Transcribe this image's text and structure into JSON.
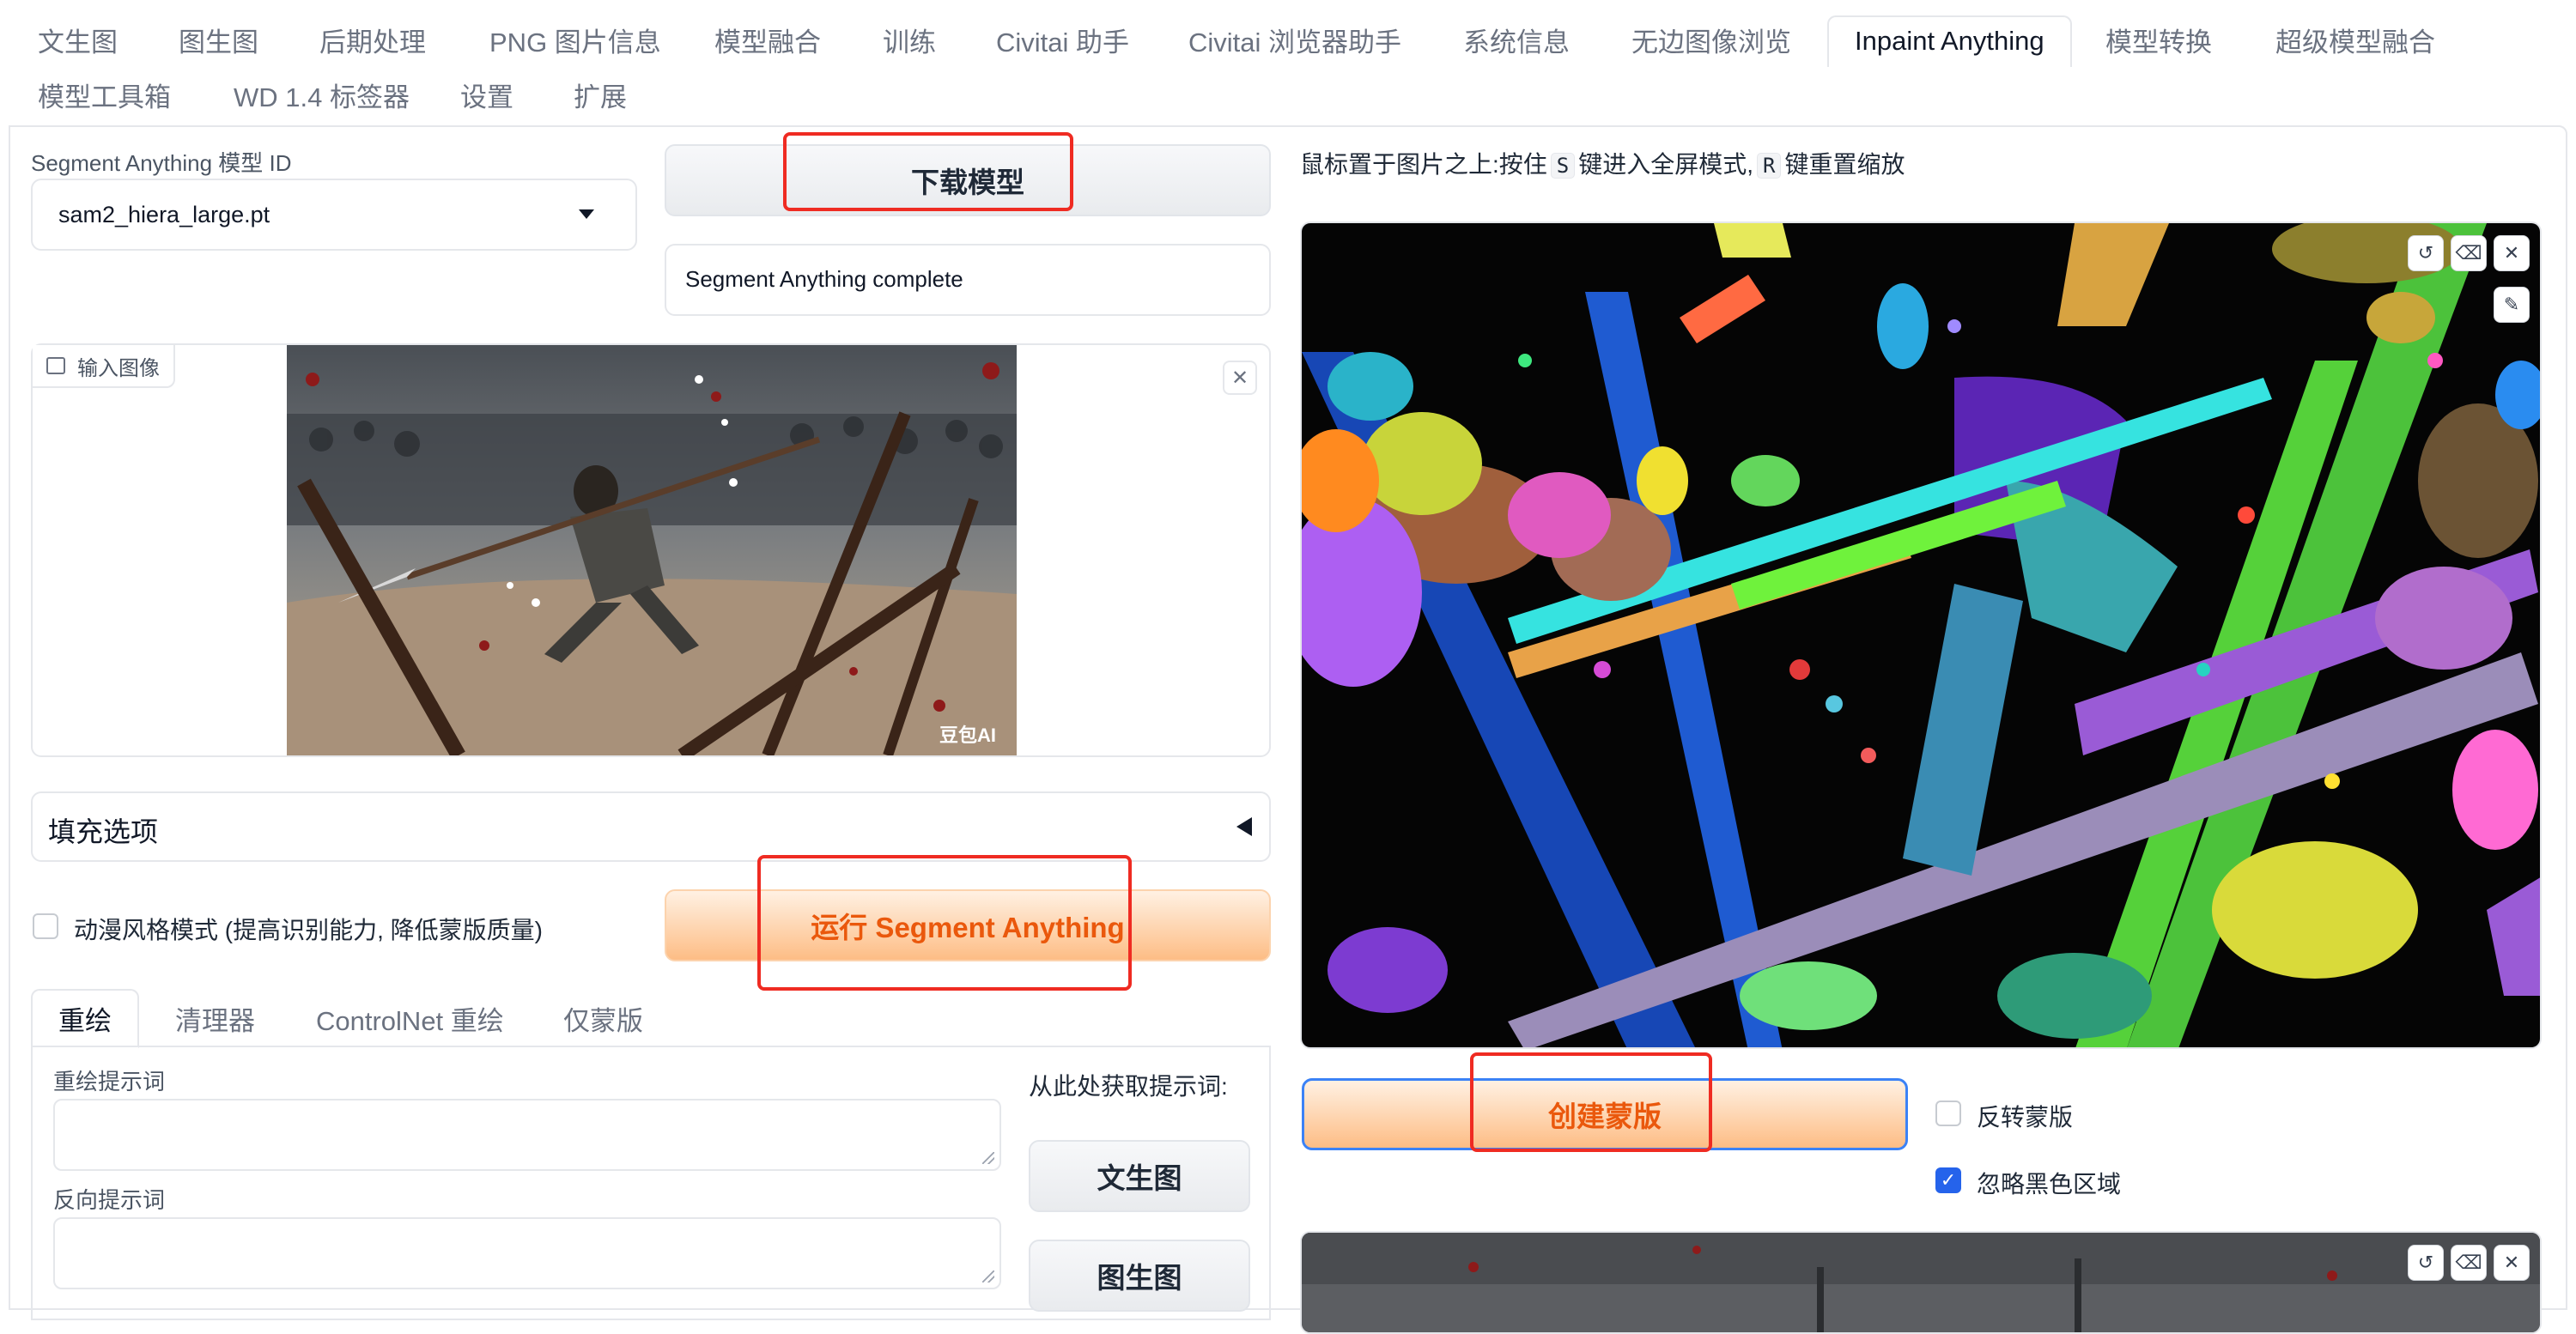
{
  "tabs": {
    "row1": [
      "文生图",
      "图生图",
      "后期处理",
      "PNG 图片信息",
      "模型融合",
      "训练",
      "Civitai 助手",
      "Civitai 浏览器助手",
      "系统信息",
      "无边图像浏览",
      "Inpaint Anything",
      "模型转换",
      "超级模型融合"
    ],
    "row2": [
      "模型工具箱",
      "WD 1.4 标签器",
      "设置",
      "扩展"
    ],
    "active": "Inpaint Anything"
  },
  "left": {
    "model_id_label": "Segment Anything 模型 ID",
    "model_id_value": "sam2_hiera_large.pt",
    "download_button": "下载模型",
    "status_text": "Segment Anything complete",
    "input_image_label": "输入图像",
    "input_image_watermark": "豆包AI",
    "fill_options_label": "填充选项",
    "anime_mode_label": "动漫风格模式 (提高识别能力, 降低蒙版质量)",
    "run_button": "运行 Segment Anything",
    "subtabs": [
      "重绘",
      "清理器",
      "ControlNet 重绘",
      "仅蒙版"
    ],
    "prompt_label": "重绘提示词",
    "negative_prompt_label": "反向提示词",
    "get_prompt_from_label": "从此处获取提示词:",
    "txt2img_button": "文生图",
    "img2img_button": "图生图"
  },
  "right": {
    "hint_prefix": "鼠标置于图片之上:按住",
    "hint_key_s": "S",
    "hint_middle": "键进入全屏模式,",
    "hint_key_r": "R",
    "hint_suffix": "键重置缩放",
    "create_mask_button": "创建蒙版",
    "invert_mask_label": "反转蒙版",
    "ignore_black_label": "忽略黑色区域"
  },
  "state": {
    "anime_mode_checked": false,
    "invert_mask_checked": false,
    "ignore_black_checked": true
  },
  "colors": {
    "accent_orange": "#ea580c",
    "highlight_red": "#ef2b22",
    "check_blue": "#2563eb"
  }
}
